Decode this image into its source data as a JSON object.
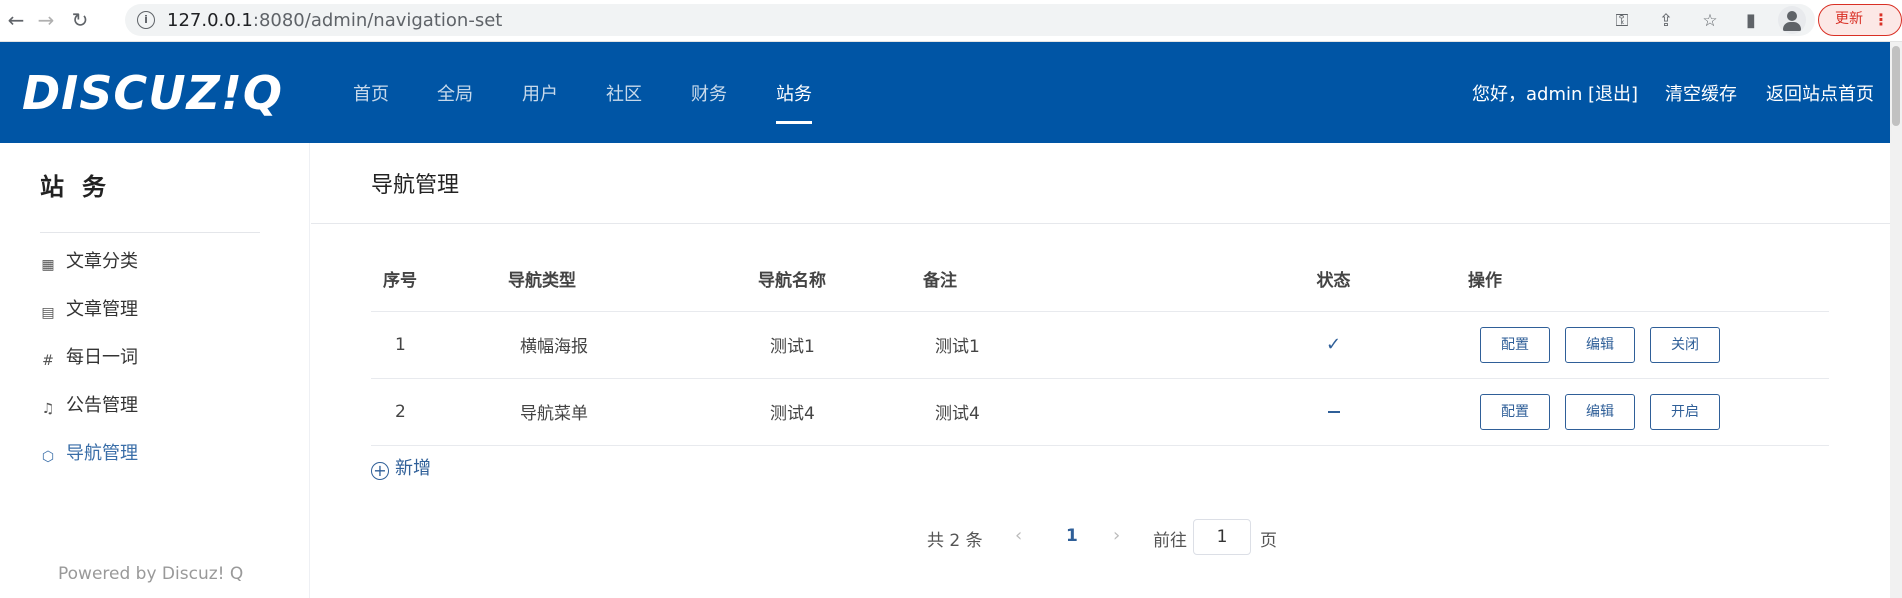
{
  "browser": {
    "url_host": "127.0.0.1",
    "url_rest": ":8080/admin/navigation-set",
    "update_label": "更新"
  },
  "header": {
    "logo": "DISCUZ!Q",
    "nav": [
      "首页",
      "全局",
      "用户",
      "社区",
      "财务",
      "站务"
    ],
    "active_nav": "站务",
    "greeting": "您好，admin",
    "logout": "[退出]",
    "clear_cache": "清空缓存",
    "back_home": "返回站点首页"
  },
  "sidebar": {
    "title": "站务",
    "items": [
      {
        "label": "文章分类",
        "icon": "grid-icon"
      },
      {
        "label": "文章管理",
        "icon": "document-icon"
      },
      {
        "label": "每日一词",
        "icon": "hash-icon"
      },
      {
        "label": "公告管理",
        "icon": "bell-icon"
      },
      {
        "label": "导航管理",
        "icon": "cube-icon",
        "active": true
      }
    ],
    "powered": "Powered by Discuz! Q"
  },
  "main": {
    "page_title": "导航管理",
    "columns": [
      "序号",
      "导航类型",
      "导航名称",
      "备注",
      "状态",
      "操作"
    ],
    "rows": [
      {
        "index": "1",
        "type": "横幅海报",
        "name": "测试1",
        "note": "测试1",
        "status": "on",
        "actions": [
          "配置",
          "编辑",
          "关闭"
        ]
      },
      {
        "index": "2",
        "type": "导航菜单",
        "name": "测试4",
        "note": "测试4",
        "status": "off",
        "actions": [
          "配置",
          "编辑",
          "开启"
        ]
      }
    ],
    "add_label": "新增"
  },
  "pagination": {
    "total": "共 2 条",
    "current": "1",
    "goto_label": "前往",
    "goto_value": "1",
    "page_suffix": "页"
  },
  "colors": {
    "header_bg": "#0055a5",
    "accent": "#2f5f98"
  }
}
